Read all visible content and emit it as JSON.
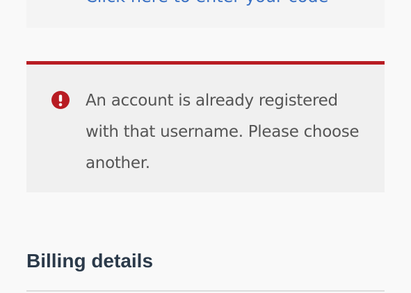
{
  "coupon": {
    "link_text": "Click here to enter your code"
  },
  "error_notice": {
    "icon": "exclamation-circle-icon",
    "message": "An account is already registered with that username. Please choose another.",
    "accent_color": "#b81c23"
  },
  "billing": {
    "title": "Billing details"
  }
}
